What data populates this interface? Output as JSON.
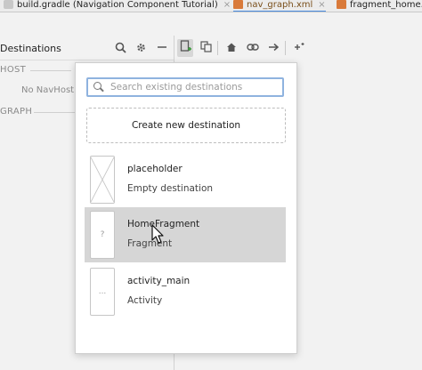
{
  "tabs": [
    {
      "label": "build.gradle (Navigation Component Tutorial)",
      "icon": "gradle-icon",
      "active": false
    },
    {
      "label": "nav_graph.xml",
      "icon": "xml-file-icon",
      "active": true
    },
    {
      "label": "fragment_home.x",
      "icon": "xml-file-icon",
      "active": false
    }
  ],
  "tab_close": "×",
  "destinations": {
    "title": "Destinations",
    "sections": {
      "host": "HOST",
      "graph": "GRAPH"
    },
    "no_host_text": "No NavHostF"
  },
  "icons": {
    "search": "search-icon",
    "settings": "gear-icon",
    "collapse": "minus-icon",
    "new_destination": "new-destination-icon",
    "copy": "copy-icon",
    "home": "home-icon",
    "link": "link-icon",
    "action": "arrow-right-icon",
    "auto_arrange": "auto-arrange-icon"
  },
  "popup": {
    "search_placeholder": "Search existing destinations",
    "create_label": "Create new destination",
    "items": [
      {
        "name": "placeholder",
        "type": "Empty destination",
        "thumb": "placeholder"
      },
      {
        "name": "HomeFragment",
        "type": "Fragment",
        "thumb": "?"
      },
      {
        "name": "activity_main",
        "type": "Activity",
        "thumb": "..."
      }
    ]
  },
  "colors": {
    "accent": "#4a8be0",
    "hover": "#d6d6d6"
  }
}
